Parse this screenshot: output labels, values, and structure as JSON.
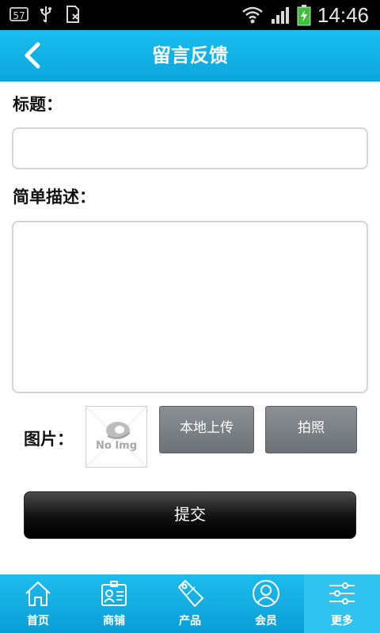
{
  "status_bar": {
    "badge": "57",
    "time": "14:46"
  },
  "header": {
    "title": "留言反馈"
  },
  "form": {
    "title_label": "标题：",
    "title_value": "",
    "desc_label": "简单描述：",
    "desc_value": "",
    "image_label": "图片：",
    "image_placeholder_text": "No Img",
    "upload_local_label": "本地上传",
    "camera_label": "拍照",
    "submit_label": "提交"
  },
  "bottom_nav": {
    "items": [
      {
        "label": "首页",
        "icon": "home-icon"
      },
      {
        "label": "商铺",
        "icon": "shop-card-icon"
      },
      {
        "label": "产品",
        "icon": "sale-tag-icon"
      },
      {
        "label": "会员",
        "icon": "user-icon"
      },
      {
        "label": "更多",
        "icon": "sliders-icon"
      }
    ],
    "active_index": 4
  }
}
